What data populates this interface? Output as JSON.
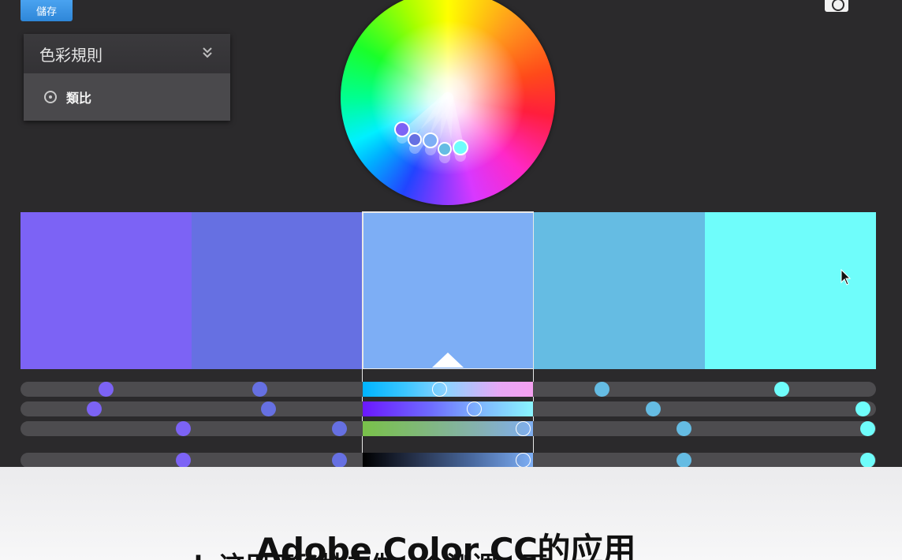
{
  "toolbar": {
    "save_label": "儲存"
  },
  "rule_panel": {
    "title": "色彩規則",
    "selected_rule": "類比"
  },
  "swatches": [
    {
      "color": "#7c63f5"
    },
    {
      "color": "#6670e2"
    },
    {
      "color": "#7daef5"
    },
    {
      "color": "#65bce3"
    },
    {
      "color": "#6ffdfb"
    }
  ],
  "active_swatch_index": 2,
  "slider_gradients": [
    "linear-gradient(90deg, #00b4ff, #3cc6ff 25%, #8fd2ff 50%, #e7a8f5 80%, #f4a0f0)",
    "linear-gradient(90deg, #6b18ff, #6e6cff 40%, #7fb8ff 70%, #8af5ff)",
    "linear-gradient(90deg, #79c14a, #80b87a 35%, #85b0b4 70%, #7faef0)",
    "linear-gradient(90deg, #000000, #253049 30%, #4a6aa0 65%, #7daef5)"
  ],
  "sliders": [
    {
      "knobs": [
        0.1,
        0.28,
        0.49,
        0.68,
        0.89
      ]
    },
    {
      "knobs": [
        0.086,
        0.29,
        0.53,
        0.74,
        0.985
      ]
    },
    {
      "knobs": [
        0.19,
        0.373,
        0.588,
        0.776,
        0.99
      ]
    },
    {
      "knobs": [
        0.19,
        0.373,
        0.588,
        0.776,
        0.99
      ]
    }
  ],
  "subtitle": {
    "title": "Adobe Color CC的应用",
    "line": "ok  这用正确地去做一个测调一下"
  },
  "icons": {
    "rule_chevron": "chevron-double-down-icon",
    "rule_radio": "radio-icon",
    "camera": "camera-icon",
    "cursor": "mouse-cursor-icon"
  }
}
